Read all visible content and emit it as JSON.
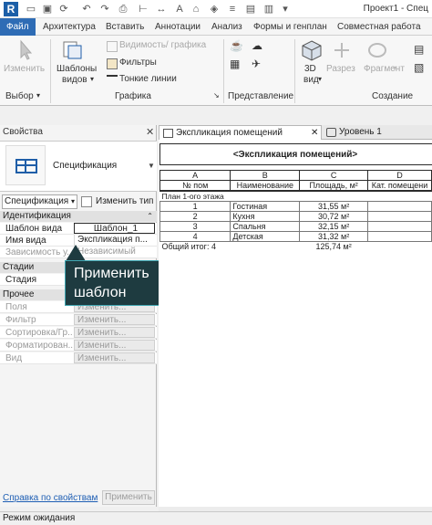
{
  "titlebar": {
    "title": "Проект1 - Спец"
  },
  "ribbon": {
    "tabs": [
      "Файл",
      "Архитектура",
      "Вставить",
      "Аннотации",
      "Анализ",
      "Формы и генплан",
      "Совместная работа"
    ],
    "modify_label": "Изменить",
    "view_templates_label_1": "Шаблоны",
    "view_templates_label_2": "видов",
    "visibility_label": "Видимость/ графика",
    "filters_label": "Фильтры",
    "thin_lines_label": "Тонкие линии",
    "threed_label_1": "3D",
    "threed_label_2": "вид",
    "section_label": "Разрез",
    "fragment_label": "Фрагмент",
    "groups": {
      "select": "Выбор",
      "graphics": "Графика",
      "presentation": "Представление",
      "create": "Создание"
    }
  },
  "properties": {
    "header": "Свойства",
    "type_name": "Спецификация",
    "type_select": "Спецификация",
    "edit_type": "Изменить тип",
    "sections": {
      "identity": "Идентификация",
      "phases": "Стадии",
      "other": "Прочее"
    },
    "rows": {
      "view_template_name": "Шаблон вида",
      "view_template_value": "Шаблон_1",
      "view_name_name": "Имя вида",
      "view_name_value": "Экспликация п...",
      "dependency_name": "Зависимость у...",
      "dependency_value": "Независимый",
      "phase_name": "Стадия",
      "fields_name": "Поля",
      "filter_name": "Фильтр",
      "sort_name": "Сортировка/Гр...",
      "format_name": "Форматирован...",
      "appearance_name": "Вид",
      "edit_value": "Изменить..."
    },
    "help_link": "Справка по свойствам",
    "apply": "Применить"
  },
  "callout": {
    "line1": "Применить",
    "line2": "шаблон"
  },
  "view_tabs": [
    "Экспликация помещений",
    "Уровень 1"
  ],
  "schedule": {
    "title": "<Экспликация помещений>",
    "letters": [
      "A",
      "B",
      "C",
      "D"
    ],
    "headers": [
      "№ пом",
      "Наименование",
      "Площадь, м²",
      "Кат. помещени"
    ],
    "group": "План 1-ого этажа",
    "rows": [
      {
        "num": "1",
        "name": "Гостиная",
        "area": "31,55 м²"
      },
      {
        "num": "2",
        "name": "Кухня",
        "area": "30,72 м²"
      },
      {
        "num": "3",
        "name": "Спальня",
        "area": "32,15 м²"
      },
      {
        "num": "4",
        "name": "Детская",
        "area": "31,32 м²"
      }
    ],
    "total_label": "Общий итог: 4",
    "total_area": "125,74 м²"
  },
  "status": {
    "text": "Режим ожидания"
  },
  "colors": {
    "accent": "#2e6cb5",
    "callout_bg": "#1e3b40",
    "callout_border": "#41a8b3"
  }
}
